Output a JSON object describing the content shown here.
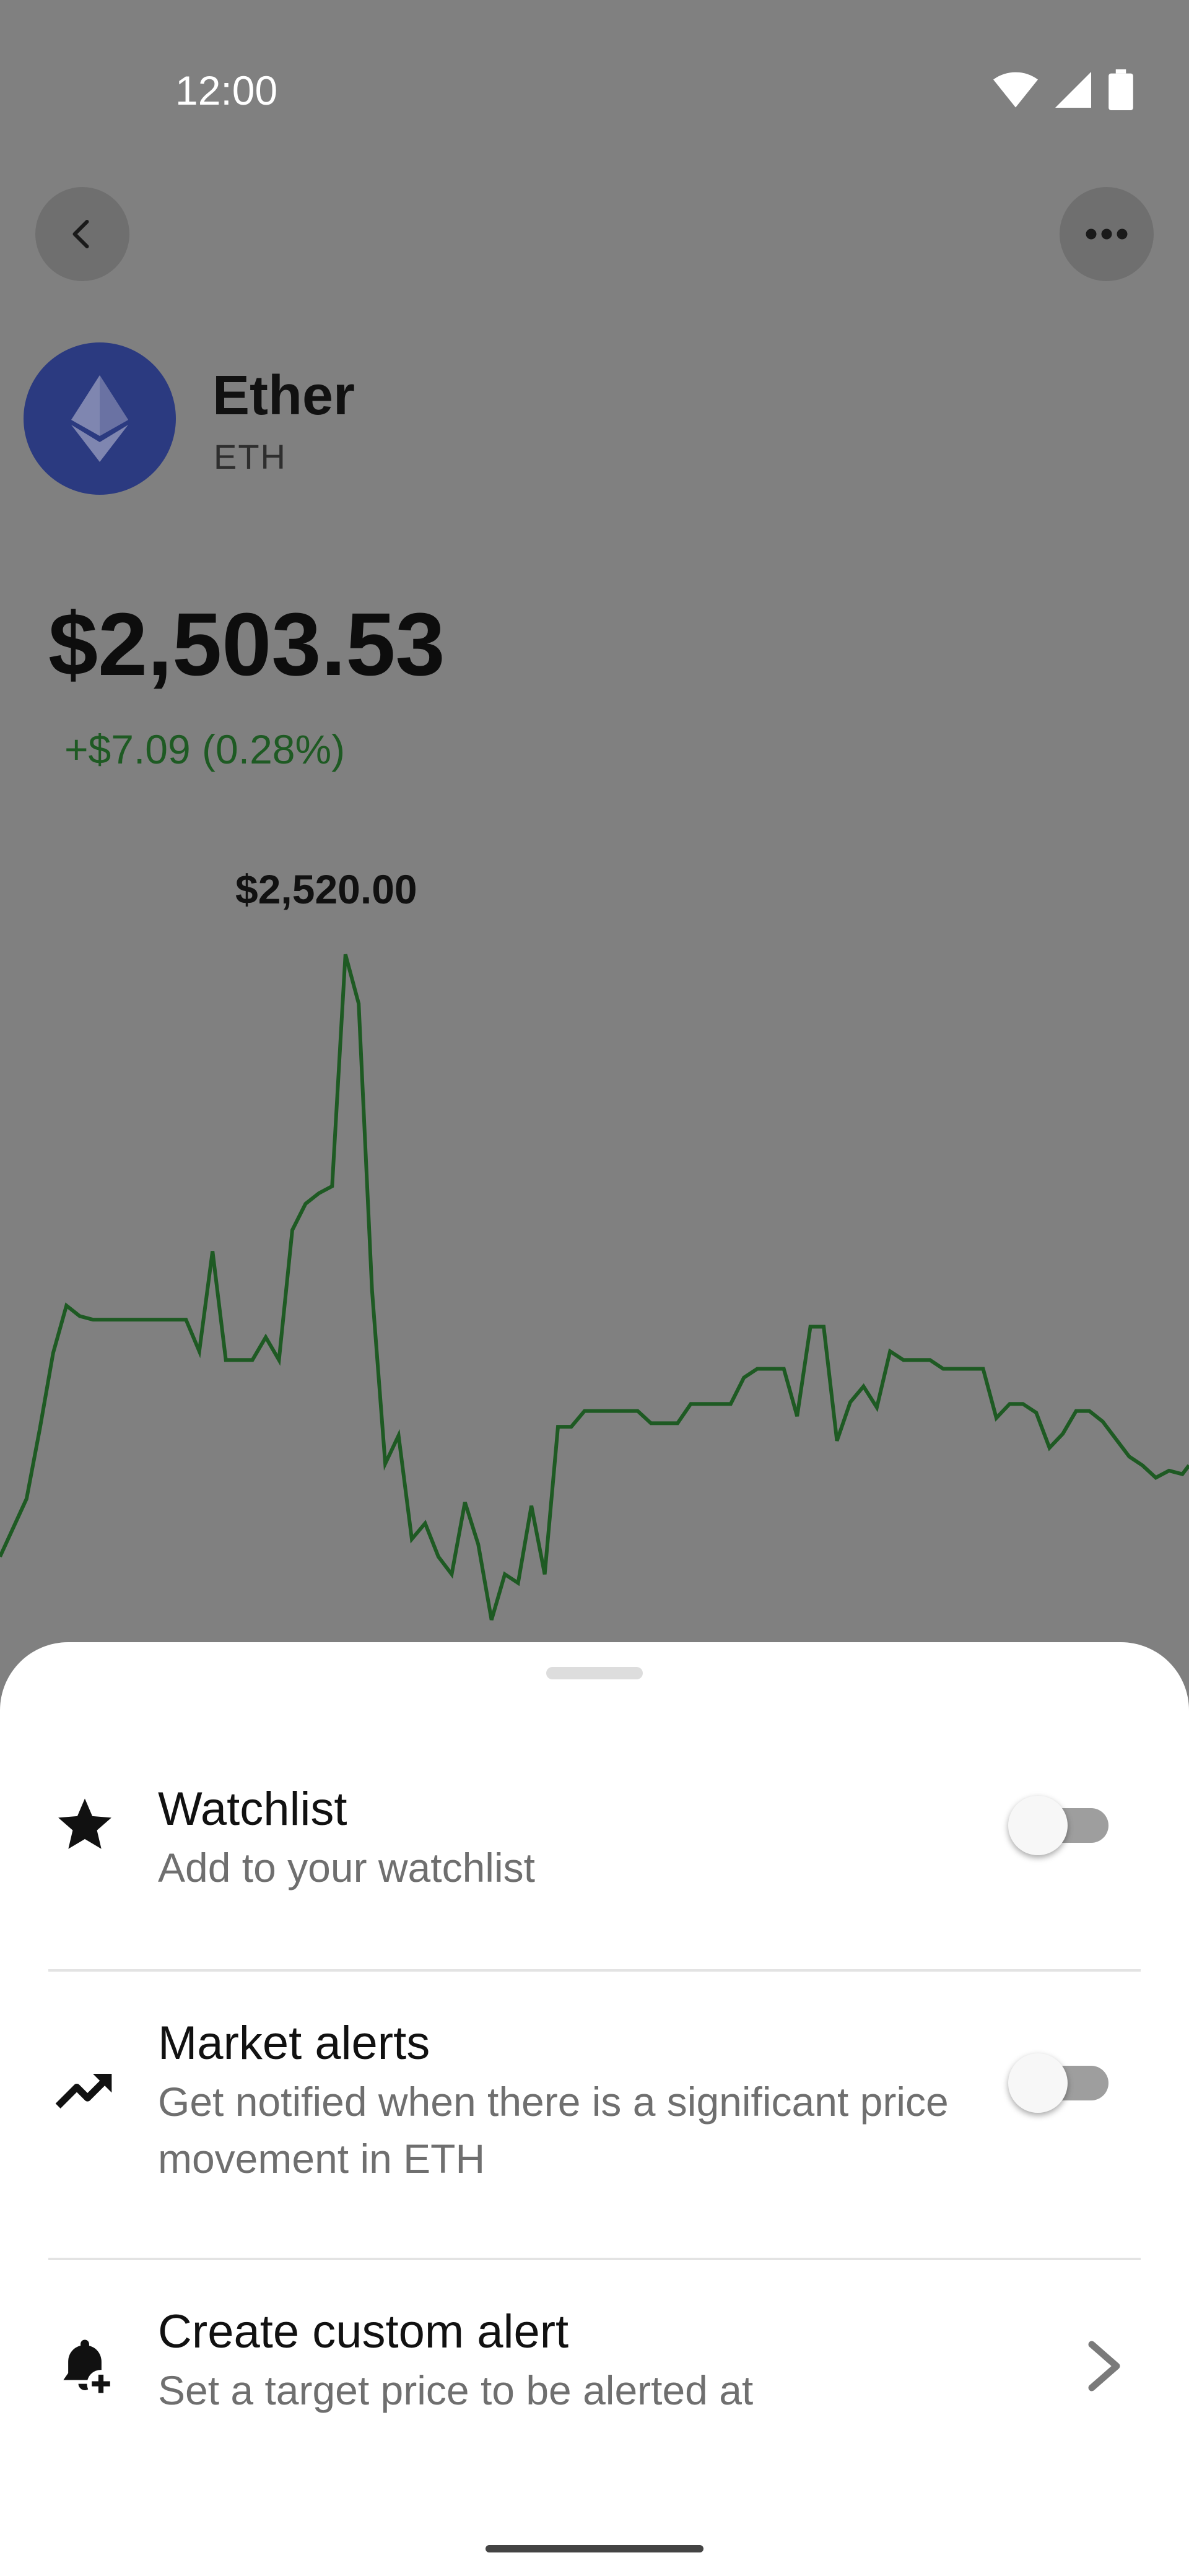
{
  "status_bar": {
    "time": "12:00",
    "icons": [
      "wifi-icon",
      "cell-signal-icon",
      "battery-icon"
    ]
  },
  "header": {
    "back_icon": "chevron-left-icon",
    "more_icon": "more-horizontal-icon"
  },
  "coin": {
    "name": "Ether",
    "ticker": "ETH",
    "logo_icon": "ethereum-icon",
    "logo_color": "#2b3a80"
  },
  "price": {
    "value": "$2,503.53",
    "change": "+$7.09 (0.28%)",
    "change_color": "#1e5a23"
  },
  "chart_data": {
    "type": "line",
    "peak_label": "$2,520.00",
    "line_color": "#1e5a23",
    "y_max": 2520.0,
    "y_min": 2480.5,
    "x_range": [
      0,
      179
    ],
    "x": [
      0,
      4,
      6,
      8,
      10,
      12,
      14,
      16,
      18,
      20,
      22,
      24,
      26,
      28,
      30,
      32,
      34,
      36,
      38,
      40,
      42,
      44,
      46,
      48,
      50,
      52,
      54,
      56,
      58,
      60,
      62,
      64,
      66,
      68,
      70,
      72,
      74,
      76,
      78,
      80,
      82,
      84,
      86,
      88,
      90,
      92,
      94,
      96,
      98,
      100,
      102,
      104,
      106,
      108,
      110,
      112,
      114,
      116,
      118,
      120,
      122,
      124,
      126,
      128,
      130,
      132,
      134,
      136,
      138,
      140,
      142,
      144,
      146,
      148,
      150,
      152,
      154,
      156,
      158,
      160,
      162,
      164,
      166,
      168,
      170,
      172,
      174,
      176,
      178,
      179
    ],
    "values": [
      2485.3,
      2488.6,
      2492.6,
      2496.9,
      2499.6,
      2499.0,
      2498.8,
      2498.8,
      2498.8,
      2498.8,
      2498.8,
      2498.8,
      2498.8,
      2498.8,
      2497.0,
      2502.7,
      2496.5,
      2496.5,
      2496.5,
      2497.8,
      2496.5,
      2503.9,
      2505.4,
      2506.0,
      2506.4,
      2519.6,
      2516.8,
      2500.5,
      2490.6,
      2492.2,
      2486.3,
      2487.2,
      2485.3,
      2484.3,
      2488.4,
      2486.0,
      2481.7,
      2484.3,
      2483.8,
      2488.2,
      2484.3,
      2492.7,
      2492.7,
      2493.6,
      2493.6,
      2493.6,
      2493.6,
      2493.6,
      2492.9,
      2492.9,
      2492.9,
      2494.0,
      2494.0,
      2494.0,
      2494.0,
      2495.5,
      2496.0,
      2496.0,
      2496.0,
      2493.3,
      2498.4,
      2498.4,
      2491.9,
      2494.1,
      2495.0,
      2493.8,
      2497.0,
      2496.5,
      2496.5,
      2496.5,
      2496.0,
      2496.0,
      2496.0,
      2496.0,
      2493.2,
      2494.0,
      2494.0,
      2493.5,
      2491.5,
      2492.3,
      2493.6,
      2493.6,
      2493.0,
      2492.0,
      2491.0,
      2490.5,
      2489.8,
      2490.2,
      2490.0,
      2490.5
    ]
  },
  "sheet": {
    "items": [
      {
        "icon": "star-icon",
        "title": "Watchlist",
        "subtitle": "Add to your watchlist",
        "control": "toggle",
        "toggle_on": false
      },
      {
        "icon": "trending-up-icon",
        "title": "Market alerts",
        "subtitle": "Get notified when there is a significant price movement in ETH",
        "control": "toggle",
        "toggle_on": false
      },
      {
        "icon": "bell-plus-icon",
        "title": "Create custom alert",
        "subtitle": "Set a target price to be alerted at",
        "control": "chevron-right-icon"
      }
    ]
  }
}
